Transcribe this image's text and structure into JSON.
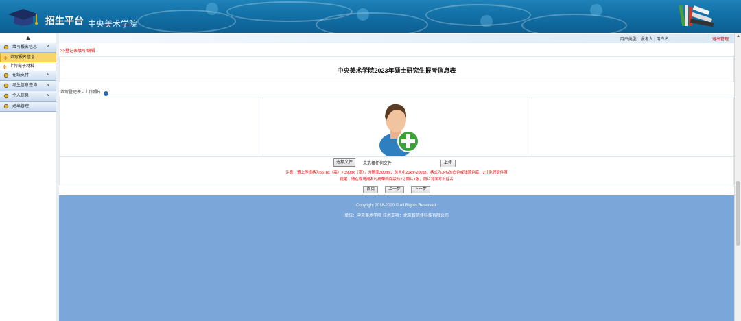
{
  "header": {
    "platform_title": "招生平台",
    "school_name": "中央美术学院"
  },
  "userbar": {
    "user_type": "用户类型：报考人 | 用户名",
    "logout": "退出管理"
  },
  "sidebar": {
    "items": [
      {
        "label": "填写报名信息",
        "arrow": "˄",
        "icon": "gear-icon"
      },
      {
        "label": "填写报名信息",
        "active": true,
        "icon": "flower-icon"
      },
      {
        "label": "上传电子材料",
        "icon": "flower-icon"
      },
      {
        "label": "在线支付",
        "arrow": "˅",
        "icon": "gear-icon"
      },
      {
        "label": "考生信息查询",
        "arrow": "˅",
        "icon": "gear-icon"
      },
      {
        "label": "个人信息",
        "arrow": "˅",
        "icon": "gear-icon"
      },
      {
        "label": "退出管理",
        "icon": "gear-icon"
      }
    ]
  },
  "main": {
    "breadcrumb": ">>登记表填写/编辑",
    "form_title": "中央美术学院2023年硕士研究生报考信息表",
    "section_label": "填写登记表 - 上传照片",
    "upload": {
      "choose_file": "选择文件",
      "no_file": "未选择任何文件",
      "upload_button": "上传"
    },
    "notice_1": "注意：请上传规格为567px（高）× 390px（宽），分辨率300dpi，总大小20kb~200kb，格式为JPG的白色或浅蓝色底，2寸免冠证件照",
    "notice_2": "提醒：请在现场报名时携带同底版的2寸照片1张，照片背面写上姓名",
    "pager": {
      "first": "首页",
      "prev": "上一步",
      "next": "下一步"
    }
  },
  "footer": {
    "copyright": "Copyright 2018-2020 © All Rights Reserved.",
    "unit": "单位：中央美术学院   技术支持：北京智信佳科技有限公司"
  },
  "colors": {
    "header_blue": "#1270a6",
    "footer_blue": "#7ba6d9",
    "notice_red": "#e00000",
    "active_nav": "#f6d56d"
  }
}
